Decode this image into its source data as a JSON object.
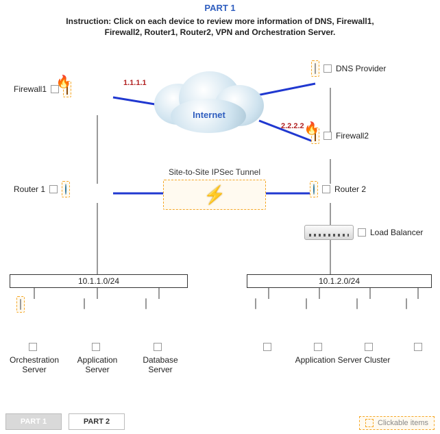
{
  "title": "PART 1",
  "instruction": "Instruction: Click on each device to review more information of DNS, Firewall1, Firewall2, Router1, Router2, VPN and Orchestration Server.",
  "cloud_label": "Internet",
  "ips": {
    "fw1": "1.1.1.1",
    "fw2": "2.2.2.2"
  },
  "tunnel_label": "Site-to-Site IPSec Tunnel",
  "devices": {
    "firewall1": "Firewall1",
    "firewall2": "Firewall2",
    "dns": "DNS Provider",
    "router1": "Router 1",
    "router2": "Router 2",
    "lb": "Load Balancer"
  },
  "subnets": {
    "left": "10.1.1.0/24",
    "right": "10.1.2.0/24"
  },
  "bottom": {
    "orch": "Orchestration Server",
    "app": "Application Server",
    "db": "Database Server",
    "cluster": "Application Server Cluster"
  },
  "buttons": {
    "part1": "PART 1",
    "part2": "PART 2"
  },
  "legend": "Clickable items"
}
